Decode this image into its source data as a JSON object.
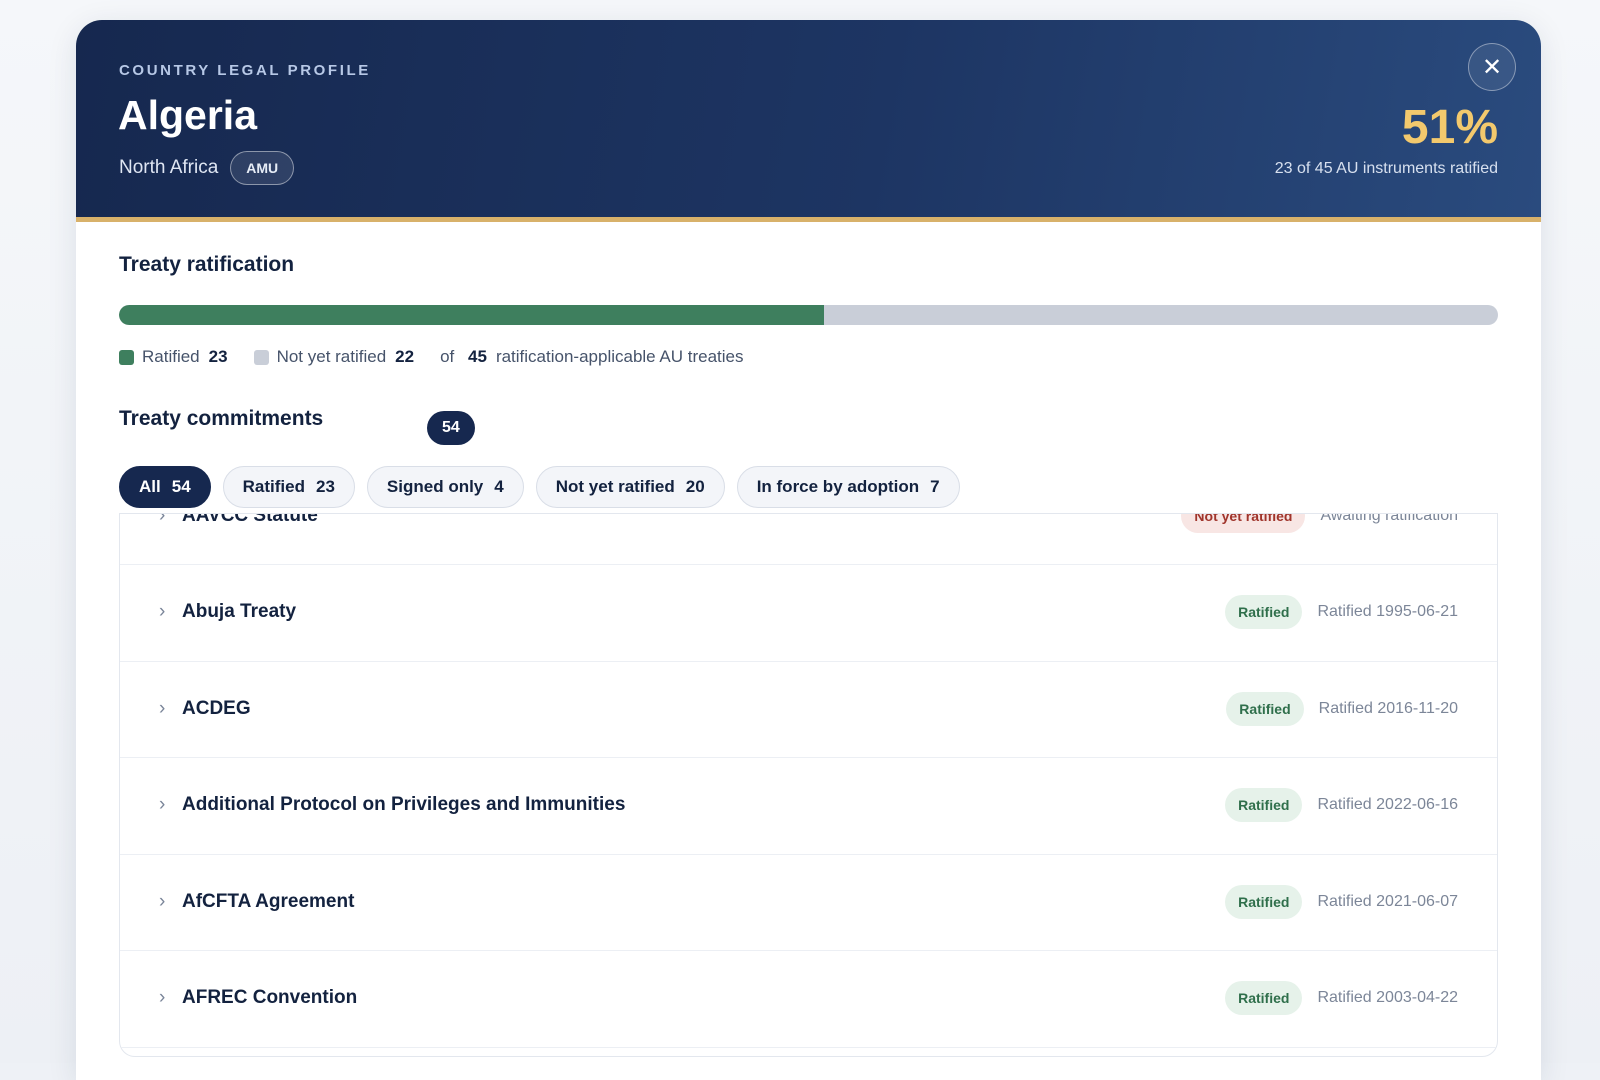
{
  "header": {
    "eyebrow": "COUNTRY LEGAL PROFILE",
    "country": "Algeria",
    "region": "North Africa",
    "bloc": "AMU",
    "percent": "51%",
    "percent_value": 51,
    "summary": "23 of 45 AU instruments ratified",
    "close_icon": "close-icon"
  },
  "ratification": {
    "title": "Treaty ratification",
    "ratified_label": "Ratified",
    "ratified_count": "23",
    "not_ratified_label": "Not yet ratified",
    "not_ratified_count": "22",
    "of_label": "of",
    "total": "45",
    "total_suffix": "ratification-applicable AU treaties",
    "ratified_fraction": 0.511,
    "colors": {
      "ratified": "#3e7f5e",
      "not_ratified": "#c9ced8"
    }
  },
  "commitments": {
    "title": "Treaty commitments",
    "count": "54",
    "filters": [
      {
        "label": "All",
        "count": "54",
        "active": true
      },
      {
        "label": "Ratified",
        "count": "23",
        "active": false
      },
      {
        "label": "Signed only",
        "count": "4",
        "active": false
      },
      {
        "label": "Not yet ratified",
        "count": "20",
        "active": false
      },
      {
        "label": "In force by adoption",
        "count": "7",
        "active": false
      }
    ],
    "rows": [
      {
        "name": "AAVCC Statute",
        "status": "Not yet ratified",
        "kind": "no",
        "date": "Awaiting ratification"
      },
      {
        "name": "Abuja Treaty",
        "status": "Ratified",
        "kind": "ok",
        "date": "Ratified 1995-06-21"
      },
      {
        "name": "ACDEG",
        "status": "Ratified",
        "kind": "ok",
        "date": "Ratified 2016-11-20"
      },
      {
        "name": "Additional Protocol on Privileges and Immunities",
        "status": "Ratified",
        "kind": "ok",
        "date": "Ratified 2022-06-16"
      },
      {
        "name": "AfCFTA Agreement",
        "status": "Ratified",
        "kind": "ok",
        "date": "Ratified 2021-06-07"
      },
      {
        "name": "AFREC Convention",
        "status": "Ratified",
        "kind": "ok",
        "date": "Ratified 2003-04-22"
      }
    ],
    "chevron_icon": "chevron-right-icon"
  }
}
